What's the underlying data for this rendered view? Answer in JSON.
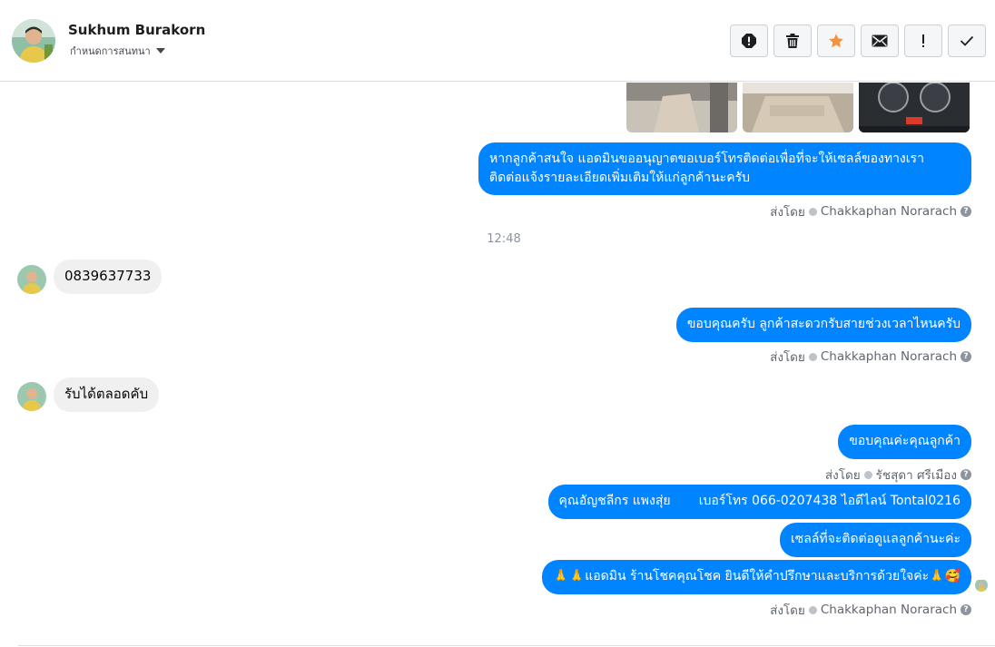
{
  "header": {
    "contact_name": "Sukhum Burakorn",
    "assign_label": "กำหนดการสนทนา"
  },
  "actions": [
    {
      "name": "mark-spam-icon"
    },
    {
      "name": "trash-icon"
    },
    {
      "name": "star-icon"
    },
    {
      "name": "mark-unread-icon"
    },
    {
      "name": "follow-up-icon"
    },
    {
      "name": "done-check-icon"
    }
  ],
  "colors": {
    "outgoing_bubble": "#0084ff",
    "incoming_bubble": "#f1f0f0",
    "star": "#f7923a"
  },
  "messages": [
    {
      "text_1": "หากลูกค้าสนใจ แอดมินขออนุญาตขอเบอร์โทรติดต่อเพื่อที่จะให้เซลล์ของทางเรา",
      "text_2": "ติดต่อแจ้งรายละเอียดเพิ่มเติมให้แก่ลูกค้านะครับ",
      "sent_by_label": "ส่งโดย",
      "sender": "Chakkaphan Norarach"
    },
    {
      "time": "12:48"
    },
    {
      "text": "0839637733"
    },
    {
      "text": "ขอบคุณครับ ลูกค้าสะดวกรับสายช่วงเวลาไหนครับ",
      "sent_by_label": "ส่งโดย",
      "sender": "Chakkaphan Norarach"
    },
    {
      "text": "รับได้ตลอดคับ"
    },
    {
      "text": "ขอบคุณค่ะคุณลูกค้า",
      "sent_by_label": "ส่งโดย",
      "sender": "รัชสุดา ศรีเมือง"
    },
    {
      "text": "คุณอัญชลีกร แพงสุ่ย       เบอร์โทร 066-0207438 ไอดีไลน์ Tontal0216"
    },
    {
      "text": "เซลล์ที่จะติดต่อดูแลลูกค้านะค่ะ"
    },
    {
      "text": "🙏🙏แอดมิน ร้านโชคคุณโชค ยินดีให้คำปรึกษาและบริการด้วยใจค่ะ🙏🥰",
      "sent_by_label": "ส่งโดย",
      "sender": "Chakkaphan Norarach"
    }
  ]
}
